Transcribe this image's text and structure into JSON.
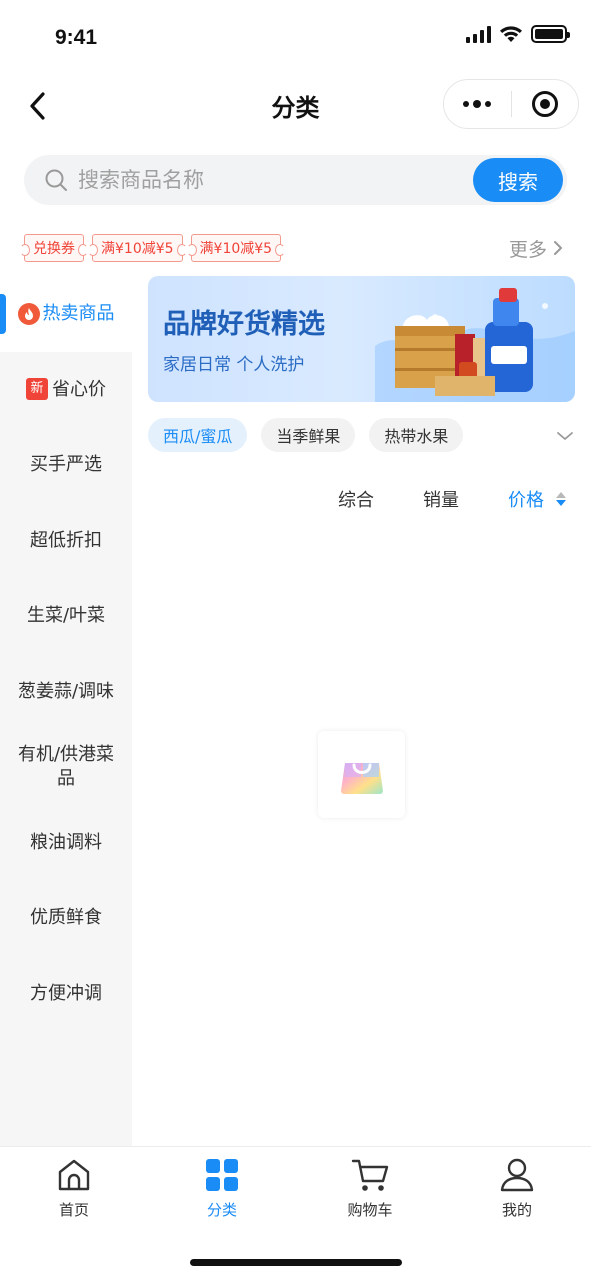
{
  "status_bar": {
    "time": "9:41"
  },
  "nav": {
    "title": "分类"
  },
  "search": {
    "placeholder": "搜索商品名称",
    "button_label": "搜索"
  },
  "coupons": [
    "兑换券",
    "满¥10减¥5",
    "满¥10减¥5"
  ],
  "more_label": "更多",
  "sidebar": {
    "items": [
      {
        "label": "热卖商品",
        "active": true,
        "icon": "fire-icon"
      },
      {
        "label": "省心价",
        "badge": "新"
      },
      {
        "label": "买手严选"
      },
      {
        "label": "超低折扣"
      },
      {
        "label": "生菜/叶菜"
      },
      {
        "label": "葱姜蒜/调味"
      },
      {
        "label": "有机/供港菜品"
      },
      {
        "label": "粮油调料"
      },
      {
        "label": "优质鲜食"
      },
      {
        "label": "方便冲调"
      }
    ]
  },
  "banner": {
    "title": "品牌好货精选",
    "subtitle": "家居日常 个人洗护"
  },
  "chips": [
    {
      "label": "西瓜/蜜瓜",
      "active": true
    },
    {
      "label": "当季鲜果"
    },
    {
      "label": "热带水果"
    }
  ],
  "sort": {
    "overall": "综合",
    "sales": "销量",
    "price": "价格"
  },
  "tabbar": {
    "items": [
      {
        "label": "首页",
        "icon": "home-icon"
      },
      {
        "label": "分类",
        "icon": "category-icon",
        "active": true
      },
      {
        "label": "购物车",
        "icon": "cart-icon"
      },
      {
        "label": "我的",
        "icon": "user-icon"
      }
    ]
  },
  "colors": {
    "accent": "#1a8cf5",
    "coupon": "#f04438"
  }
}
